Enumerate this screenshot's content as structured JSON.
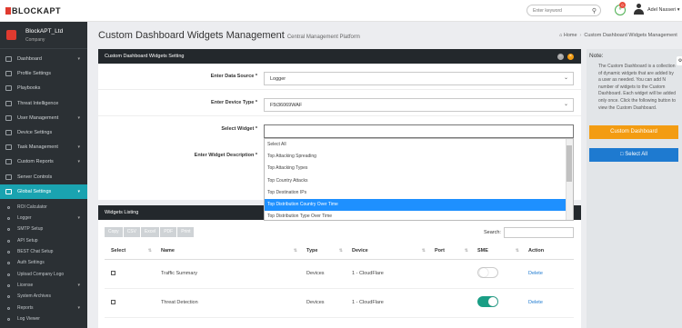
{
  "topbar": {
    "logo_text": "BLOCKAPT",
    "search_placeholder": "Enter keyword",
    "notification_count": "0",
    "user_name": "Adel Nasseri ▾"
  },
  "sidebar": {
    "company_name": "BlockAPT_Ltd",
    "company_sub": "Company",
    "items": [
      {
        "label": "Dashboard",
        "chevron": "▾"
      },
      {
        "label": "Profile Settings"
      },
      {
        "label": "Playbooks"
      },
      {
        "label": "Threat Intelligence"
      },
      {
        "label": "User Management",
        "chevron": "▾"
      },
      {
        "label": "Device Settings"
      },
      {
        "label": "Task Management",
        "chevron": "▾"
      },
      {
        "label": "Custom Reports",
        "chevron": "▾"
      },
      {
        "label": "Server Controls"
      },
      {
        "label": "Global Settings",
        "chevron": "▾"
      }
    ],
    "subitems": [
      {
        "label": "ROI Calculator"
      },
      {
        "label": "Logger",
        "chevron": "▾"
      },
      {
        "label": "SMTP Setup"
      },
      {
        "label": "API Setup"
      },
      {
        "label": "BEST Chat Setup"
      },
      {
        "label": "Auth Settings"
      },
      {
        "label": "Upload Company Logo"
      },
      {
        "label": "License",
        "chevron": "▾"
      },
      {
        "label": "System Archives"
      },
      {
        "label": "Reports",
        "chevron": "▾"
      },
      {
        "label": "Log Viewer"
      }
    ]
  },
  "header": {
    "title": "Custom Dashboard Widgets Management",
    "subtitle": "Central Management Platform",
    "breadcrumb_home": "Home",
    "breadcrumb_current": "Custom Dashboard Widgets Management"
  },
  "settings_panel": {
    "title": "Custom Dashboard Widgets Setting",
    "fields": {
      "data_source": {
        "label": "Enter Data Source *",
        "value": "Logger"
      },
      "device_type": {
        "label": "Enter Device Type *",
        "value": "F5t36069WAF"
      },
      "widget": {
        "label": "Select Widget *",
        "value": ""
      },
      "description": {
        "label": "Enter Widget Description *"
      }
    },
    "dropdown_options": [
      {
        "label": "Select All"
      },
      {
        "label": "Top Attacking Spreading"
      },
      {
        "label": "Top Attacking Types"
      },
      {
        "label": "Top Country Attacks"
      },
      {
        "label": "Top Destination IPs"
      },
      {
        "label": "Top Distribution Country Over Time",
        "selected": true
      },
      {
        "label": "Top Distribution Type Over Time"
      }
    ]
  },
  "listing": {
    "title": "Widgets Listing",
    "buttons": [
      "Copy",
      "CSV",
      "Excel",
      "PDF",
      "Print"
    ],
    "search_label": "Search:",
    "columns": [
      "Select",
      "Name",
      "Type",
      "Device",
      "Port",
      "SME",
      "Action"
    ],
    "rows": [
      {
        "name": "Traffic Summary",
        "type": "Devices",
        "device": "1 - CloudFlare",
        "port": "",
        "sme": false,
        "action": "Delete"
      },
      {
        "name": "Threat Detection",
        "type": "Devices",
        "device": "1 - CloudFlare",
        "port": "",
        "sme": true,
        "action": "Delete"
      }
    ]
  },
  "note": {
    "title": "Note:",
    "body": "The Custom Dashboard is a collection of dynamic widgets that are added by a user as needed. You can add N number of widgets to the Custom Dashboard. Each widget will be added only once. Click the following button to view the Custom Dashboard.",
    "primary_button": "Custom Dashboard",
    "secondary_button": "Select All"
  },
  "colors": {
    "accent_teal": "#1aa3b0",
    "orange": "#f39c12",
    "blue": "#1e7ad0",
    "toggle_on": "#1a9e85"
  }
}
